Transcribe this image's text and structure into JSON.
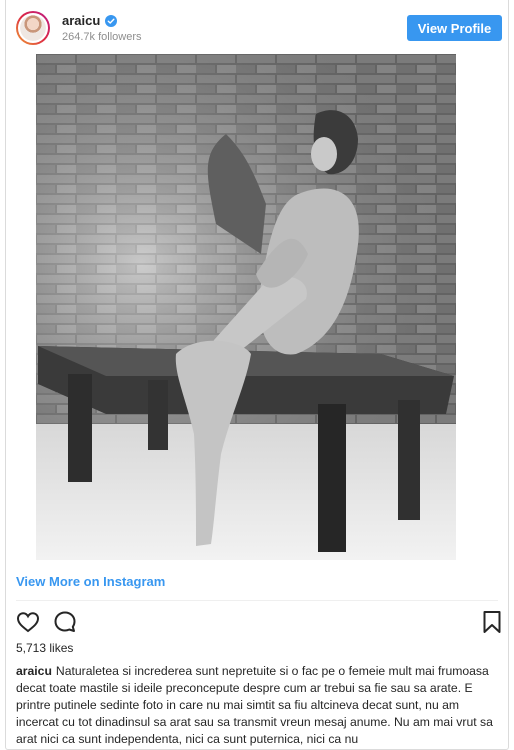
{
  "header": {
    "username": "araicu",
    "followers": "264.7k followers",
    "view_profile_label": "View Profile"
  },
  "post": {
    "view_more_label": "View More on Instagram",
    "likes": "5,713 likes",
    "caption_user": "araicu",
    "caption_text": "Naturaletea si increderea sunt nepretuite si o fac pe o femeie mult mai frumoasa decat toate mastile si ideile preconcepute despre cum ar trebui sa fie sau sa arate. E printre putinele sedinte foto in care nu mai simtit sa fiu altcineva decat sunt, nu am incercat cu tot dinadinsul sa arat sau sa transmit vreun mesaj anume. Nu am mai vrut sa arat nici ca sunt independenta, nici ca sunt puternica, nici ca nu"
  },
  "icons": {
    "verified": "verified-badge-icon",
    "like": "heart-icon",
    "comment": "comment-icon",
    "save": "bookmark-icon"
  },
  "colors": {
    "accent": "#3897f0",
    "text": "#262626",
    "muted": "#8e8e8e"
  }
}
